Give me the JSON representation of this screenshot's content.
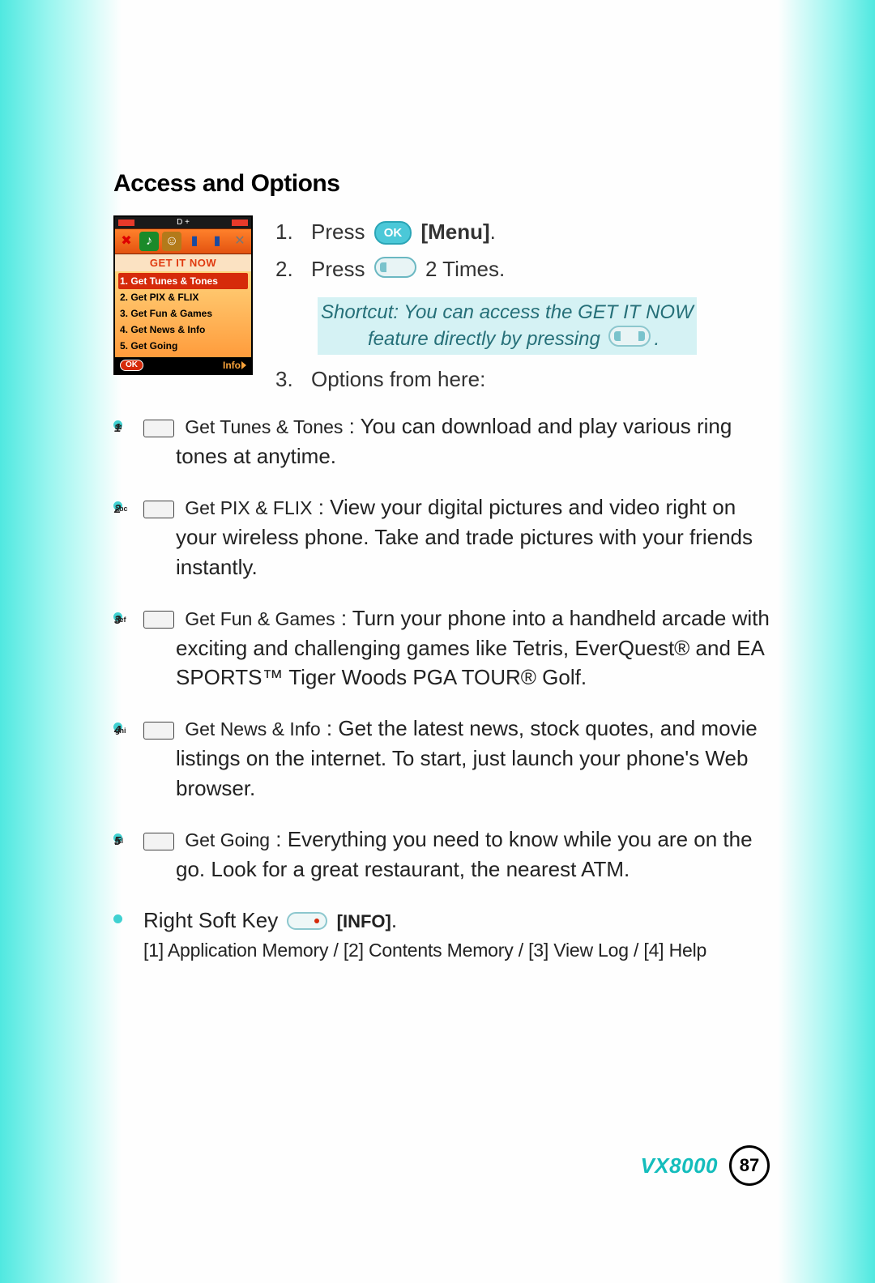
{
  "section_title": "Access and Options",
  "phone": {
    "title": "GET IT NOW",
    "items": [
      "1. Get Tunes & Tones",
      "2. Get PIX & FLIX",
      "3. Get Fun & Games",
      "4. Get News & Info",
      "5. Get Going"
    ],
    "soft_ok": "OK",
    "soft_info": "Info",
    "status_mid": "D     +"
  },
  "steps": {
    "s1_num": "1.",
    "s1_a": "Press",
    "s1_ok": "OK",
    "s1_b": "[Menu]",
    "s1_c": ".",
    "s2_num": "2.",
    "s2_a": "Press",
    "s2_b": "2 Times.",
    "shortcut_l1": "Shortcut: You can access the GET IT NOW",
    "shortcut_l2": "feature directly by pressing",
    "shortcut_dot": ".",
    "s3_num": "3.",
    "s3_a": "Options from here:"
  },
  "options": [
    {
      "key_n": "1",
      "key_s": "",
      "label": "Get Tunes & Tones",
      "text": " : You can download and play various ring tones at anytime."
    },
    {
      "key_n": "2",
      "key_s": "abc",
      "label": "Get PIX & FLIX",
      "text": " : View your digital pictures and video right on your wireless phone. Take and trade pictures with your friends instantly."
    },
    {
      "key_n": "3",
      "key_s": "def",
      "label": "Get Fun & Games",
      "text": " : Turn your phone into a handheld arcade with exciting and challenging games like Tetris, EverQuest® and EA SPORTS™ Tiger Woods PGA TOUR® Golf."
    },
    {
      "key_n": "4",
      "key_s": "ghi",
      "label": "Get News & Info",
      "text": " : Get the latest news, stock quotes, and movie listings on the internet. To start, just launch your phone's Web browser."
    },
    {
      "key_n": "5",
      "key_s": "jkl",
      "label": "Get Going",
      "text": " : Everything you need to know while you are on the go. Look for a great restaurant, the nearest ATM."
    }
  ],
  "softkey": {
    "label": "Right Soft Key",
    "info": "[INFO]",
    "dot": ".",
    "sub": "[1] Application Memory / [2] Contents Memory / [3] View Log / [4] Help"
  },
  "footer": {
    "model": "VX8000",
    "page": "87"
  }
}
